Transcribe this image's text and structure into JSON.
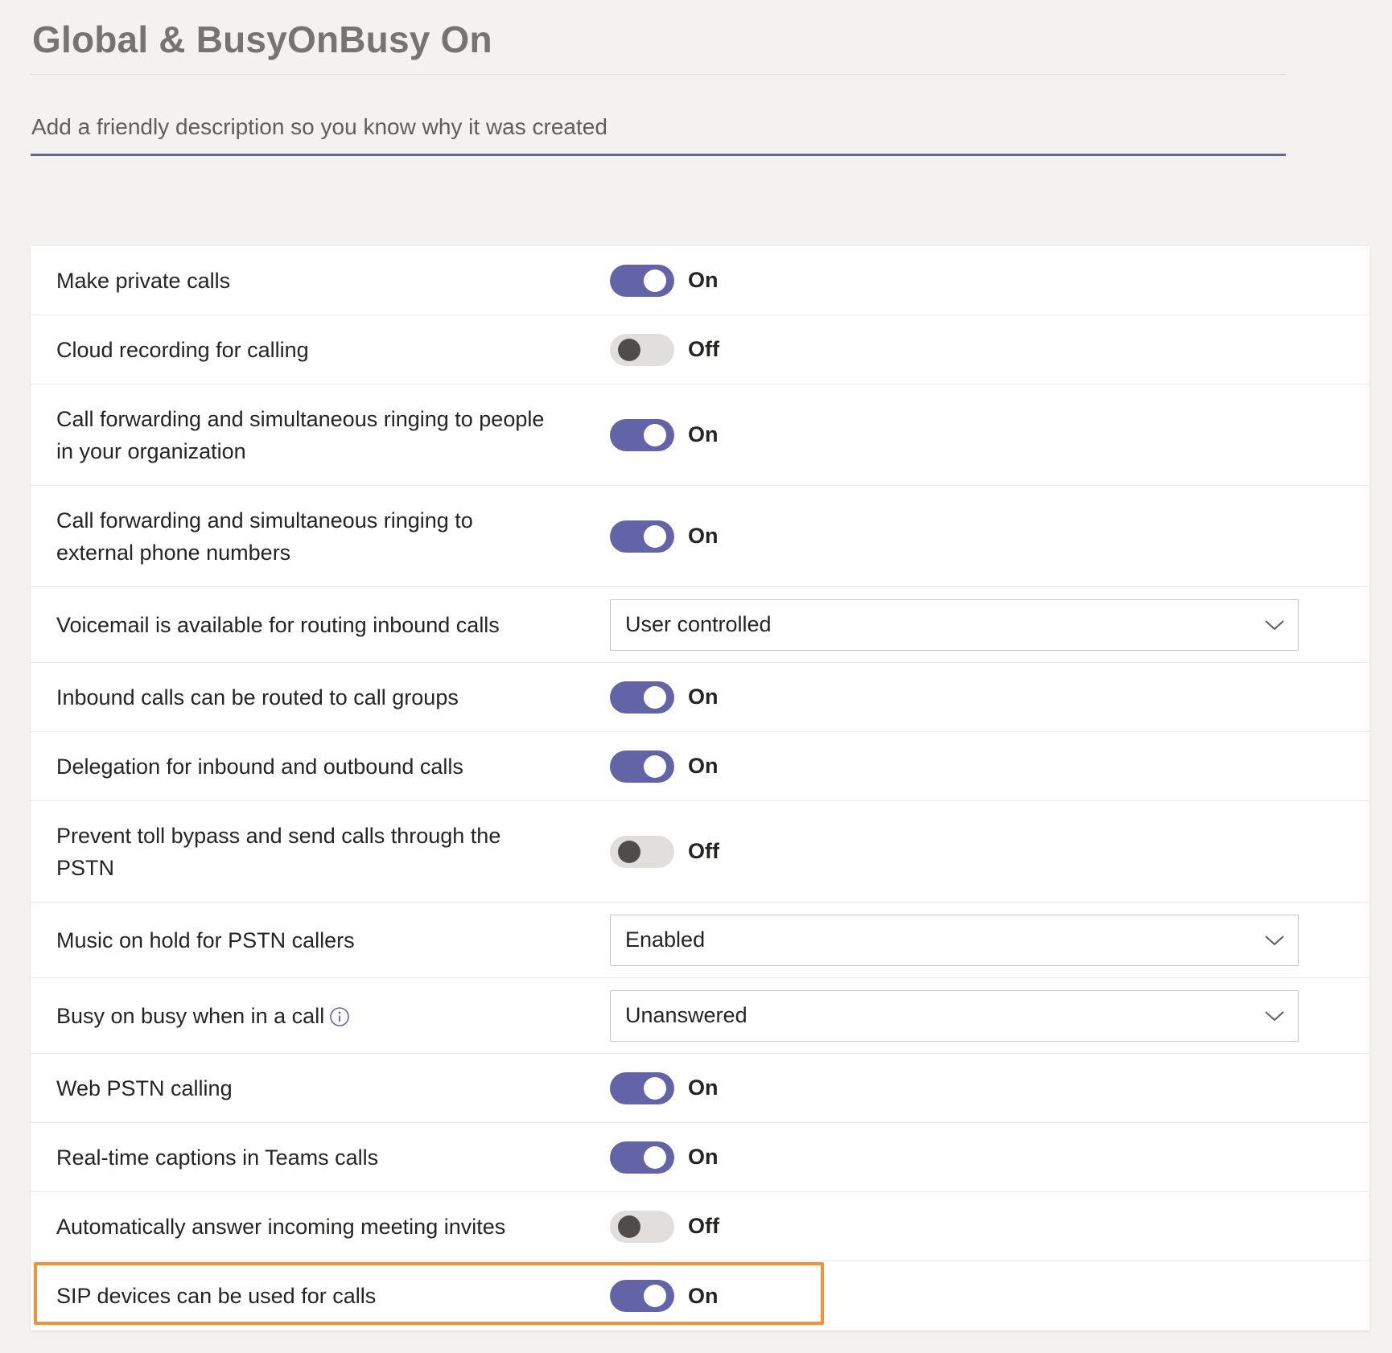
{
  "header": {
    "title": "Global & BusyOnBusy On",
    "description_placeholder": "Add a friendly description so you know why it was created",
    "description_value": ""
  },
  "settings": [
    {
      "label": "Make private calls",
      "type": "toggle",
      "state": "On"
    },
    {
      "label": "Cloud recording for calling",
      "type": "toggle",
      "state": "Off"
    },
    {
      "label": "Call forwarding and simultaneous ringing to people in your organization",
      "type": "toggle",
      "state": "On"
    },
    {
      "label": "Call forwarding and simultaneous ringing to external phone numbers",
      "type": "toggle",
      "state": "On"
    },
    {
      "label": "Voicemail is available for routing inbound calls",
      "type": "select",
      "value": "User controlled"
    },
    {
      "label": "Inbound calls can be routed to call groups",
      "type": "toggle",
      "state": "On"
    },
    {
      "label": "Delegation for inbound and outbound calls",
      "type": "toggle",
      "state": "On"
    },
    {
      "label": "Prevent toll bypass and send calls through the PSTN",
      "type": "toggle",
      "state": "Off"
    },
    {
      "label": "Music on hold for PSTN callers",
      "type": "select",
      "value": "Enabled"
    },
    {
      "label": "Busy on busy when in a call",
      "type": "select",
      "value": "Unanswered",
      "info_icon": "info-icon"
    },
    {
      "label": "Web PSTN calling",
      "type": "toggle",
      "state": "On"
    },
    {
      "label": "Real-time captions in Teams calls",
      "type": "toggle",
      "state": "On"
    },
    {
      "label": "Automatically answer incoming meeting invites",
      "type": "toggle",
      "state": "Off"
    },
    {
      "label": "SIP devices can be used for calls",
      "type": "toggle",
      "state": "On",
      "highlighted": true
    }
  ],
  "colors": {
    "accent": "#6264a7",
    "toggle_off_track": "#e1dfdd",
    "highlight_border": "#f0923a",
    "page_background": "#f3f2f1"
  }
}
